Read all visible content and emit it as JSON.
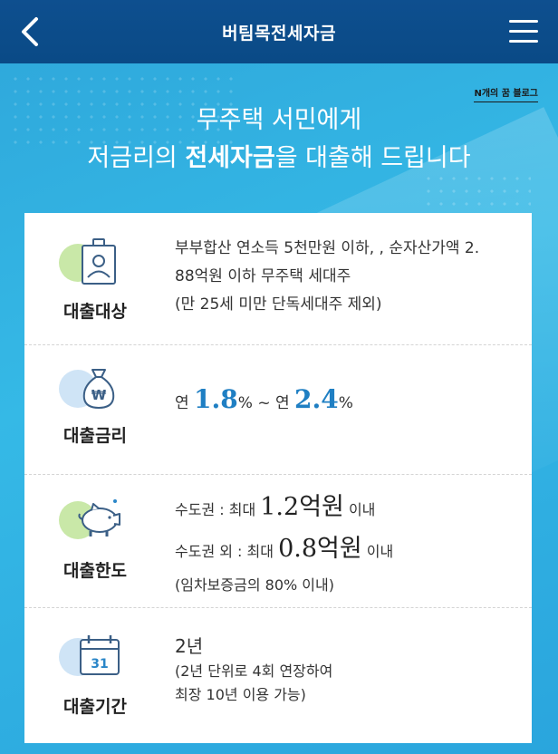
{
  "header": {
    "title": "버팀목전세자금",
    "back_icon": "chevron-left-icon",
    "menu_icon": "hamburger-menu-icon"
  },
  "hero": {
    "watermark": "N개의 꿈 블로그",
    "line1": "무주택 서민에게",
    "line2_pre": "저금리의 ",
    "line2_bold": "전세자금",
    "line2_post": "을 대출해 드립니다"
  },
  "sections": [
    {
      "label": "대출대상",
      "icon": "id-badge-icon",
      "lines": [
        "부부합산 연소득 5천만원 이하, , 순자산가액 2.",
        "88억원 이하 무주택 세대주",
        "(만 25세 미만 단독세대주 제외)"
      ]
    },
    {
      "label": "대출금리",
      "icon": "money-bag-icon",
      "rate_prefix1": "연 ",
      "rate_min": "1.8",
      "rate_unit1": "%",
      "rate_sep": " ~ 연 ",
      "rate_max": "2.4",
      "rate_unit2": "%"
    },
    {
      "label": "대출한도",
      "icon": "piggy-bank-icon",
      "line1_label": "수도권  : 최대 ",
      "line1_value": "1.2억원",
      "line1_suffix": " 이내",
      "line2_label": "수도권 외  : 최대 ",
      "line2_value": "0.8억원",
      "line2_suffix": " 이내",
      "note": "(임차보증금의 80% 이내)"
    },
    {
      "label": "대출기간",
      "icon": "calendar-icon",
      "calendar_day": "31",
      "main": "2년",
      "note1": "(2년 단위로 4회 연장하여",
      "note2": "최장 10년 이용 가능)"
    }
  ],
  "colors": {
    "header_bg": "#0a4a86",
    "hero_bg": "#35b9e6",
    "accent_blue": "#1f7fc3",
    "blob_green": "#c9e8a8",
    "blob_blue": "#cfe4f6"
  }
}
